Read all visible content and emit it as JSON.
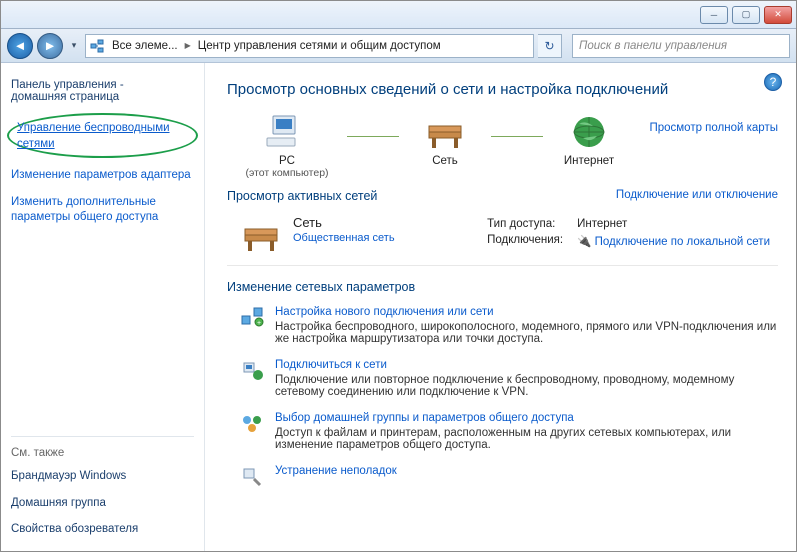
{
  "breadcrumb": {
    "root": "Все элеме...",
    "page": "Центр управления сетями и общим доступом"
  },
  "search_placeholder": "Поиск в панели управления",
  "sidebar": {
    "home1": "Панель управления -",
    "home2": "домашняя страница",
    "wireless": "Управление беспроводными сетями",
    "adapter": "Изменение параметров адаптера",
    "sharing": "Изменить дополнительные параметры общего доступа",
    "seealso_head": "См. также",
    "firewall": "Брандмауэр Windows",
    "homegroup": "Домашняя группа",
    "ieoptions": "Свойства обозревателя"
  },
  "main_heading": "Просмотр основных сведений о сети и настройка подключений",
  "full_map": "Просмотр полной карты",
  "nodes": {
    "pc": "PC",
    "pc_sub": "(этот компьютер)",
    "net": "Сеть",
    "internet": "Интернет"
  },
  "active_head": "Просмотр активных сетей",
  "connect_disconnect": "Подключение или отключение",
  "active_net": {
    "name": "Сеть",
    "type": "Общественная сеть",
    "access_label": "Тип доступа:",
    "access_value": "Интернет",
    "conn_label": "Подключения:",
    "conn_value": "Подключение по локальной сети"
  },
  "settings_head": "Изменение сетевых параметров",
  "settings": {
    "s1_title": "Настройка нового подключения или сети",
    "s1_desc": "Настройка беспроводного, широкополосного, модемного, прямого или VPN-подключения или же настройка маршрутизатора или точки доступа.",
    "s2_title": "Подключиться к сети",
    "s2_desc": "Подключение или повторное подключение к беспроводному, проводному, модемному сетевому соединению или подключение к VPN.",
    "s3_title": "Выбор домашней группы и параметров общего доступа",
    "s3_desc": "Доступ к файлам и принтерам, расположенным на других сетевых компьютерах, или изменение параметров общего доступа.",
    "s4_title": "Устранение неполадок"
  }
}
